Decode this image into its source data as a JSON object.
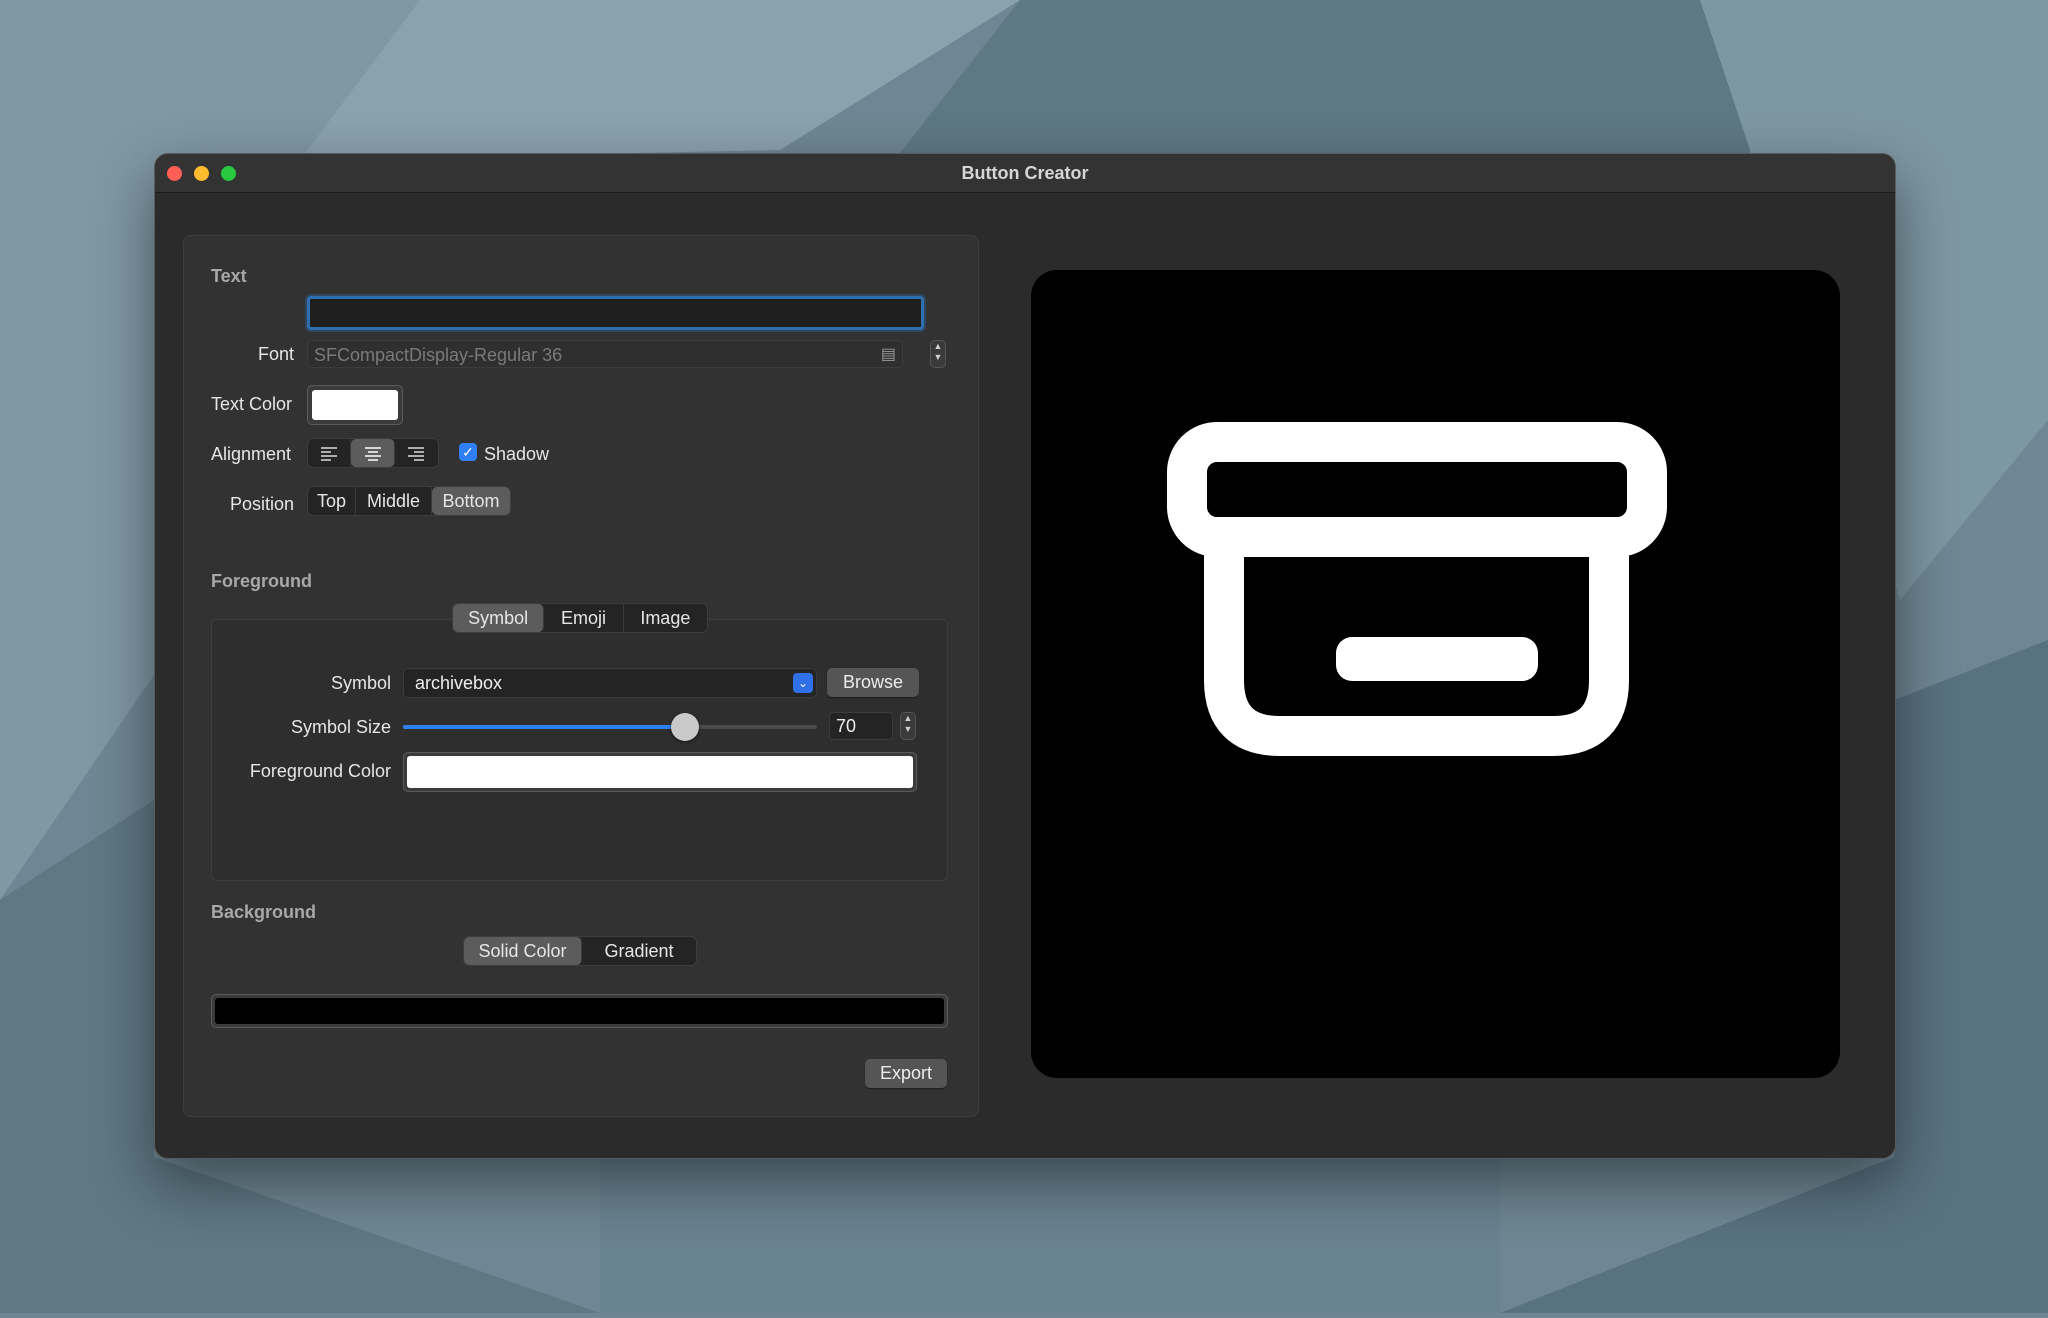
{
  "window": {
    "title": "Button Creator"
  },
  "text_section": {
    "heading": "Text",
    "text_value": "",
    "font_label": "Font",
    "font_value": "SFCompactDisplay-Regular 36",
    "text_color_label": "Text Color",
    "text_color": "#ffffff",
    "alignment_label": "Alignment",
    "alignment_options": [
      "left",
      "center",
      "right"
    ],
    "alignment_selected": "center",
    "shadow_label": "Shadow",
    "shadow_checked": true,
    "position_label": "Position",
    "position_options": [
      "Top",
      "Middle",
      "Bottom"
    ],
    "position_selected": "Bottom"
  },
  "foreground_section": {
    "heading": "Foreground",
    "tabs": [
      "Symbol",
      "Emoji",
      "Image"
    ],
    "tab_selected": "Symbol",
    "symbol_label": "Symbol",
    "symbol_value": "archivebox",
    "browse_label": "Browse",
    "symbol_size_label": "Symbol Size",
    "symbol_size_value": "70",
    "slider_fraction": 0.68,
    "foreground_color_label": "Foreground Color",
    "foreground_color": "#ffffff"
  },
  "background_section": {
    "heading": "Background",
    "tabs": [
      "Solid Color",
      "Gradient"
    ],
    "tab_selected": "Solid Color",
    "background_color": "#000000"
  },
  "export_label": "Export",
  "preview": {
    "background_color": "#000000",
    "symbol": "archivebox-icon",
    "symbol_color": "#ffffff"
  },
  "colors": {
    "accent": "#2f7ff2",
    "traffic_red": "#ff5f57",
    "traffic_yellow": "#febc2e",
    "traffic_green": "#28c840"
  }
}
